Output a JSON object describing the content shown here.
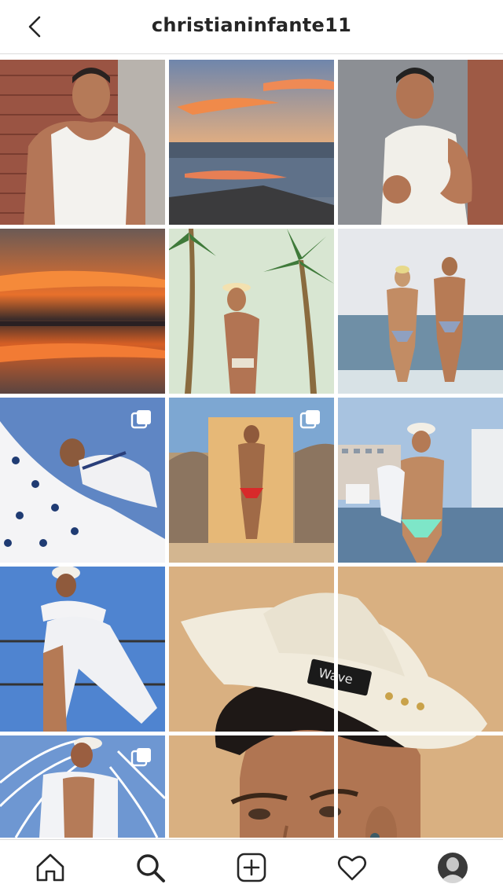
{
  "header": {
    "username": "christianinfante11"
  },
  "grid": {
    "tiles": [
      {
        "name": "post-tile-1",
        "multiple": false
      },
      {
        "name": "post-tile-2",
        "multiple": false
      },
      {
        "name": "post-tile-3",
        "multiple": false
      },
      {
        "name": "post-tile-4",
        "multiple": false
      },
      {
        "name": "post-tile-5",
        "multiple": false
      },
      {
        "name": "post-tile-6",
        "multiple": false
      },
      {
        "name": "post-tile-7",
        "multiple": true
      },
      {
        "name": "post-tile-8",
        "multiple": true
      },
      {
        "name": "post-tile-9",
        "multiple": false
      },
      {
        "name": "post-tile-10",
        "multiple": false
      },
      {
        "name": "post-tile-11",
        "multiple": false
      },
      {
        "name": "post-tile-12",
        "multiple": false
      },
      {
        "name": "post-tile-13",
        "multiple": true
      },
      {
        "name": "post-tile-14",
        "multiple": false
      },
      {
        "name": "post-tile-15",
        "multiple": false
      }
    ],
    "hat_label": "Wave"
  },
  "bottom_nav": {
    "items": [
      "home-icon",
      "search-icon",
      "new-post-icon",
      "activity-heart-icon",
      "profile-avatar"
    ]
  }
}
